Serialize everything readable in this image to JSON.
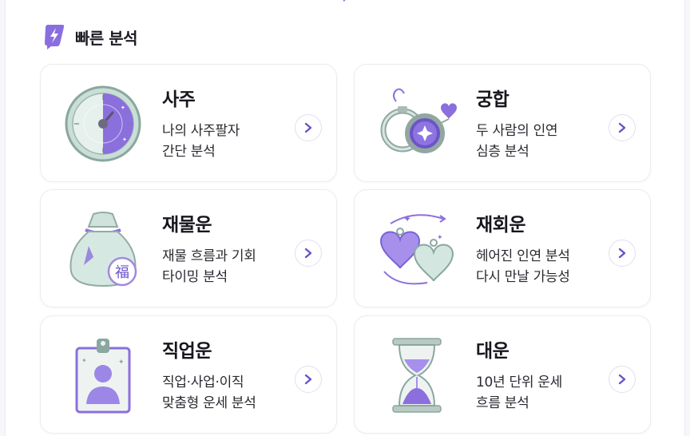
{
  "section": {
    "title": "빠른 분석",
    "icon": "lightning-bolt-icon"
  },
  "colors": {
    "accent": "#8a6ee0",
    "accent_light": "#d9ceff",
    "mint": "#cfe8e1",
    "border": "#ecebf2"
  },
  "cards": [
    {
      "title": "사주",
      "desc_line1": "나의 사주팔자",
      "desc_line2": "간단 분석",
      "illustration": "saju-dial-icon"
    },
    {
      "title": "궁합",
      "desc_line1": "두 사람의 인연",
      "desc_line2": "심층 분석",
      "illustration": "rings-icon"
    },
    {
      "title": "재물운",
      "desc_line1": "재물 흐름과 기회",
      "desc_line2": "타이밍 분석",
      "illustration": "money-bag-icon",
      "badge_char": "福"
    },
    {
      "title": "재회운",
      "desc_line1": "헤어진 인연 분석",
      "desc_line2": "다시 만날 가능성",
      "illustration": "hearts-icon"
    },
    {
      "title": "직업운",
      "desc_line1": "직업·사업·이직",
      "desc_line2": "맞춤형 운세 분석",
      "illustration": "id-badge-icon"
    },
    {
      "title": "대운",
      "desc_line1": "10년 단위 운세",
      "desc_line2": "흐름 분석",
      "illustration": "hourglass-icon"
    }
  ]
}
